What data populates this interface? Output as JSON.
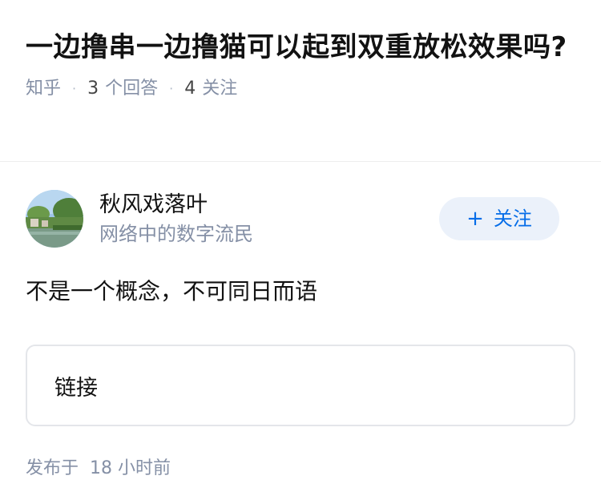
{
  "question": {
    "title": "一边撸串一边撸猫可以起到双重放松效果吗?",
    "source": "知乎",
    "answer_count": "3",
    "answer_label": "个回答",
    "follow_count": "4",
    "follow_label": "关注"
  },
  "answer": {
    "author_name": "秋风戏落叶",
    "author_bio": "网络中的数字流民",
    "follow_button_label": "关注",
    "follow_button_icon": "plus-icon",
    "content": "不是一个概念，不可同日而语",
    "link_card_label": "链接",
    "publish_label": "发布于",
    "publish_time": "18 小时前"
  },
  "colors": {
    "accent": "#056de8",
    "follow_bg": "#ebf1fa",
    "meta_text": "#8590a6",
    "primary_text": "#121212"
  }
}
